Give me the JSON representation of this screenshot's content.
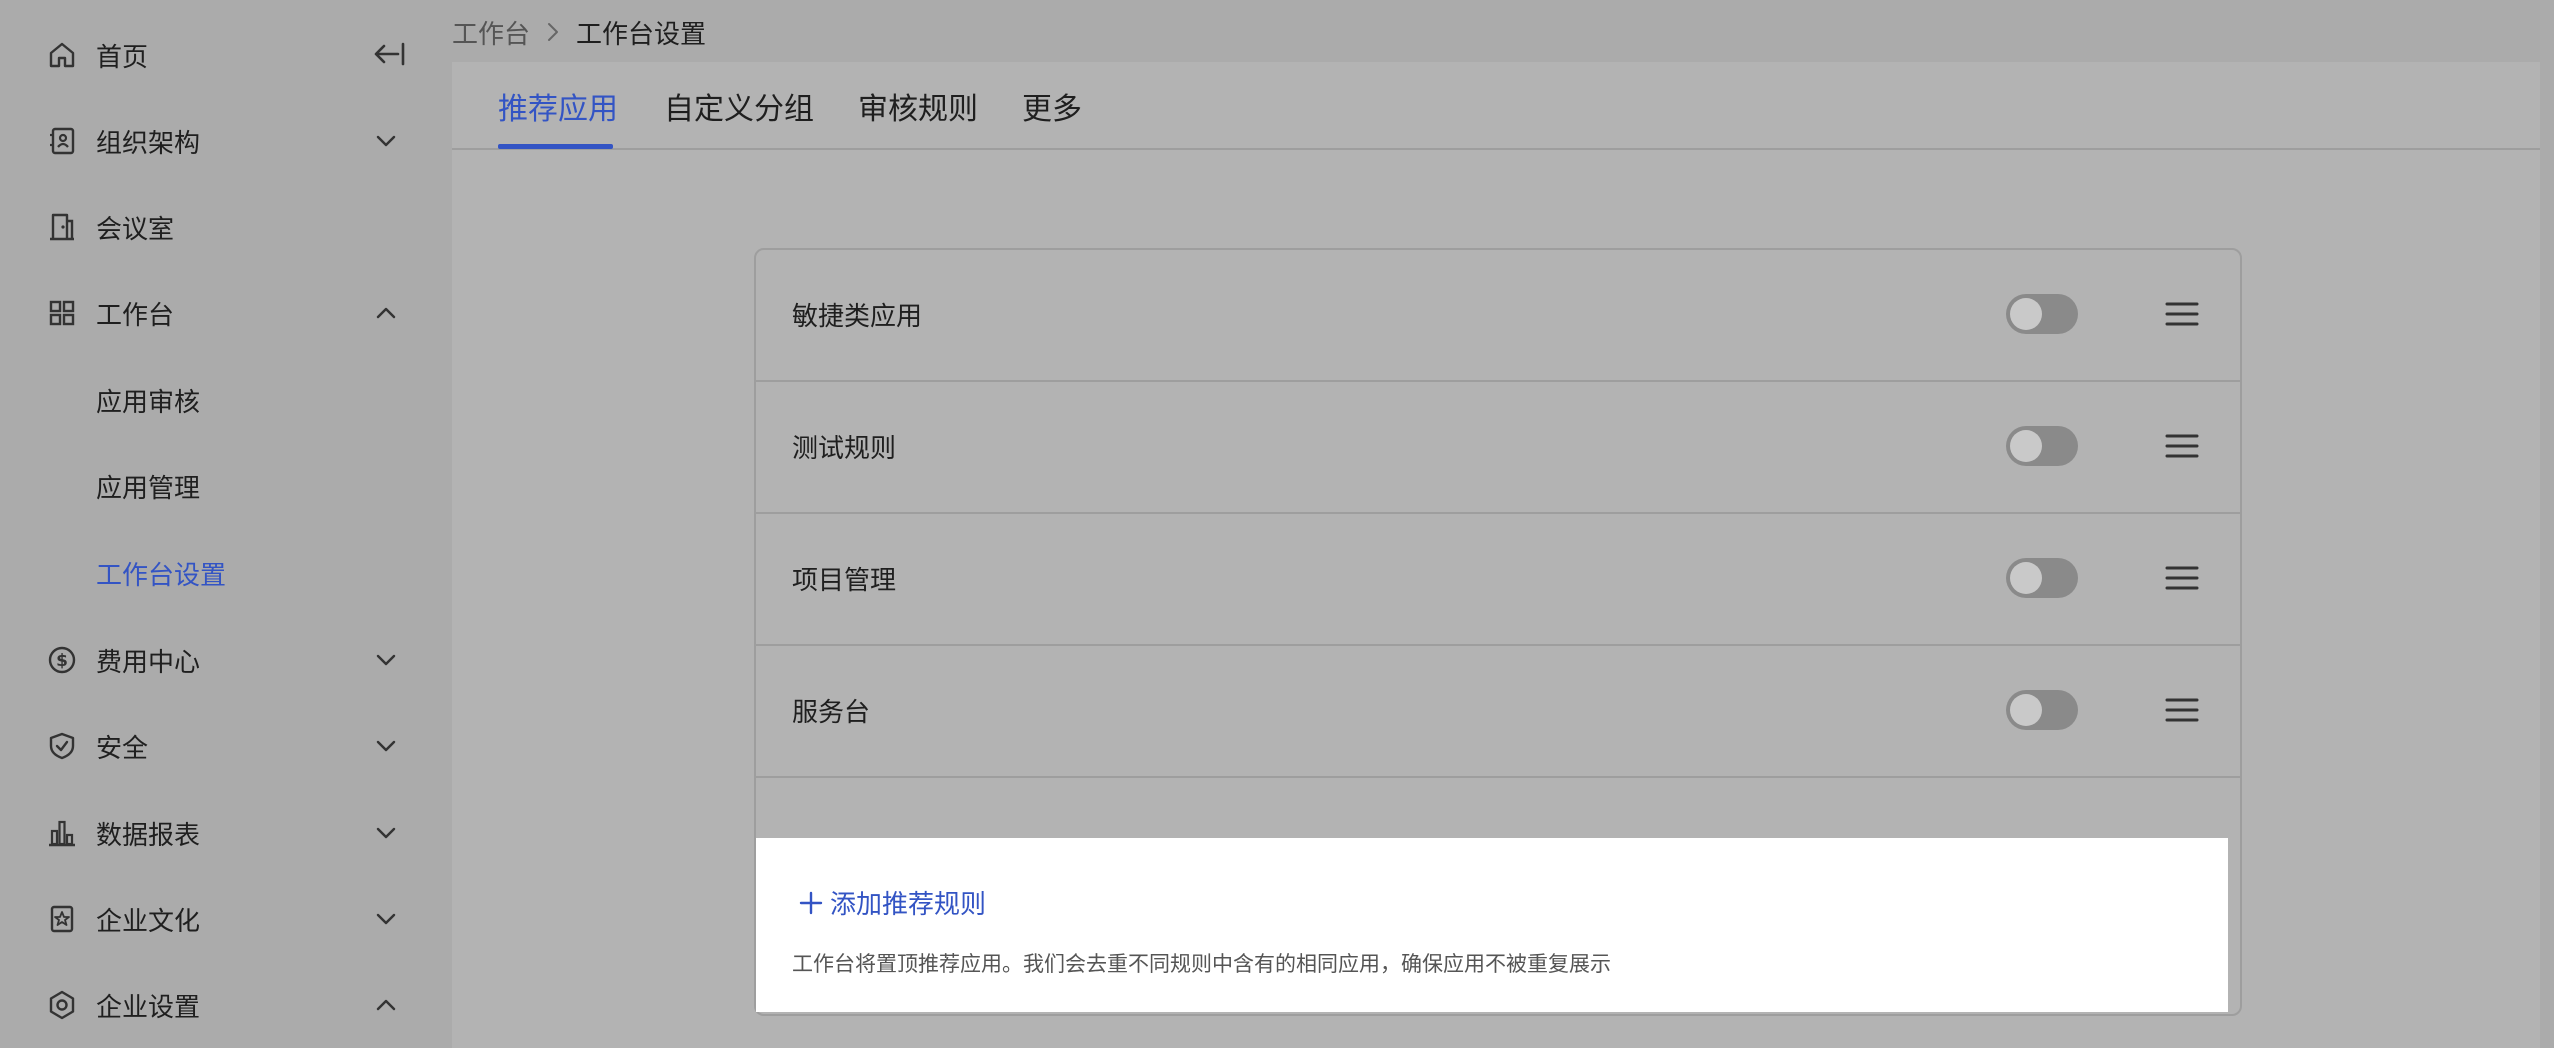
{
  "sidebar": {
    "items": [
      {
        "label": "首页",
        "icon": "home-icon"
      },
      {
        "label": "组织架构",
        "icon": "contacts-icon",
        "chevron": "down"
      },
      {
        "label": "会议室",
        "icon": "door-icon"
      },
      {
        "label": "工作台",
        "icon": "grid-icon",
        "chevron": "up"
      },
      {
        "label": "应用审核"
      },
      {
        "label": "应用管理"
      },
      {
        "label": "工作台设置",
        "active": true
      },
      {
        "label": "费用中心",
        "icon": "dollar-icon",
        "chevron": "down"
      },
      {
        "label": "安全",
        "icon": "shield-icon",
        "chevron": "down"
      },
      {
        "label": "数据报表",
        "icon": "bar-chart-icon",
        "chevron": "down"
      },
      {
        "label": "企业文化",
        "icon": "star-badge-icon",
        "chevron": "down"
      },
      {
        "label": "企业设置",
        "icon": "hexagon-settings-icon",
        "chevron": "up"
      }
    ]
  },
  "breadcrumb": {
    "parent": "工作台",
    "current": "工作台设置"
  },
  "tabs": [
    {
      "label": "推荐应用",
      "active": true
    },
    {
      "label": "自定义分组"
    },
    {
      "label": "审核规则"
    },
    {
      "label": "更多"
    }
  ],
  "rules": [
    {
      "label": "敏捷类应用",
      "enabled": false
    },
    {
      "label": "测试规则",
      "enabled": false
    },
    {
      "label": "项目管理",
      "enabled": false
    },
    {
      "label": "服务台",
      "enabled": false
    }
  ],
  "add_rule_label": "添加推荐规则",
  "hint": "工作台将置顶推荐应用。我们会去重不同规则中含有的相同应用，确保应用不被重复展示",
  "colors": {
    "accent": "#3354c4",
    "overlay": "#ababab"
  }
}
